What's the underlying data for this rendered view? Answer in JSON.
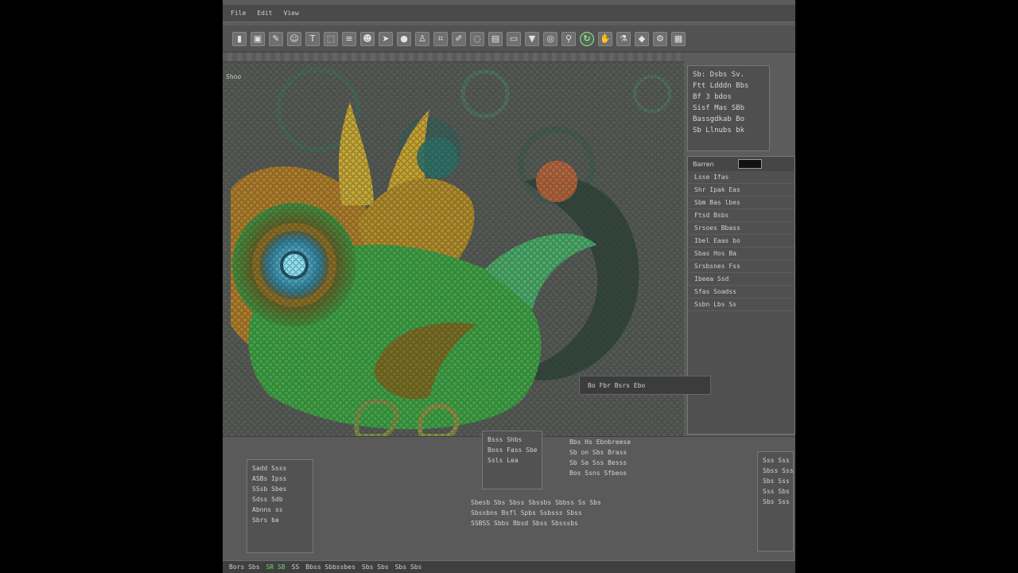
{
  "app": {
    "menu": [
      "File",
      "Edit",
      "View"
    ],
    "toolbar": [
      {
        "icon": "stamp-icon",
        "glyph": "▮"
      },
      {
        "icon": "image-icon",
        "glyph": "▣"
      },
      {
        "icon": "brush-icon",
        "glyph": "✎"
      },
      {
        "icon": "person-icon",
        "glyph": "☺"
      },
      {
        "icon": "text-icon",
        "glyph": "T"
      },
      {
        "icon": "select-icon",
        "glyph": "⬚"
      },
      {
        "icon": "layers-icon",
        "glyph": "≡"
      },
      {
        "icon": "face-icon",
        "glyph": "☻"
      },
      {
        "icon": "cursor-icon",
        "glyph": "➤"
      },
      {
        "icon": "circle-icon",
        "glyph": "●"
      },
      {
        "icon": "figure-icon",
        "glyph": "♙"
      },
      {
        "icon": "crop-icon",
        "glyph": "⌗"
      },
      {
        "icon": "pencil-icon",
        "glyph": "✐"
      },
      {
        "icon": "lasso-icon",
        "glyph": "◌"
      },
      {
        "icon": "gradient-icon",
        "glyph": "▤"
      },
      {
        "icon": "eraser-icon",
        "glyph": "▭"
      },
      {
        "icon": "fill-icon",
        "glyph": "▼"
      },
      {
        "icon": "globe-icon",
        "glyph": "◎"
      },
      {
        "icon": "zoom-icon",
        "glyph": "⚲"
      },
      {
        "icon": "rotate-icon",
        "glyph": "↻"
      },
      {
        "icon": "hand-icon",
        "glyph": "✋"
      },
      {
        "icon": "eyedropper-icon",
        "glyph": "⚗"
      },
      {
        "icon": "shape-icon",
        "glyph": "◆"
      },
      {
        "icon": "settings-icon",
        "glyph": "⚙"
      },
      {
        "icon": "grid-icon",
        "glyph": "▦"
      }
    ],
    "active_tool_index": 19,
    "canvas_label": "Shoo",
    "info_panel": [
      "Sb: Dsbs Sv.",
      "Ftt Ldddn Bbs",
      "Bf 3  bdos",
      "Sisf Mas SBb",
      "Bassgdkab  Bo",
      "Sb Llnubs bk"
    ],
    "layers_panel": {
      "title": "Barren",
      "rows": [
        "Lsse Ifas",
        "Shr Ipak Eas",
        "Sbm Bas lbes",
        "Ftsd Bsbs",
        "Srsoes Bbass",
        "Ibel Eaas bo",
        "Sbas Hos Ba",
        "Srsbsnes Fss",
        "Ibeea Ssd",
        "Sfas Soadss",
        "Ssbn Lbs Ss"
      ]
    },
    "tooltip": "Bo  Fbr Bsrs Ebo",
    "bottom_panel": {
      "left_box": [
        "Sadd  Ssss",
        "ASBs  Ipss",
        "SSsb  Sbes",
        "Sdss  Sdb",
        "Abnns  ss",
        "Sbrs  ba"
      ],
      "mid_box": [
        "Bsss Shbs",
        "Boss Fass Sbe",
        "Ssls Lea"
      ],
      "center_text": [
        "Bbs Hs  Ebnbreese",
        "Sb on Sbs Brass",
        "Sb Sa Sss Besss",
        "Bos Ssns Sfbeos"
      ],
      "footer_text": [
        "Sbesb Sbs Sbss  Sbssbs  Sbbss  Ss Sbs",
        "Sbssbns Bsfl Spbs  Ssbsss Sbss",
        "SSBSS Sbbs  Bbsd Sbss  Sbsssbs"
      ],
      "right_box": [
        "Sss  Sss",
        "Sbss  Sss",
        "Sbs  Sss",
        "Sss  Sbs",
        "Sbs  Sss"
      ]
    },
    "status_bar": [
      "Bors  Sbs",
      "SR SB",
      "SS",
      "Bbss Sbbssbes",
      "Sbs  Sbs",
      "Sbs  Sbs"
    ],
    "colors": {
      "accent": "#6fd46f",
      "panel": "#505050",
      "background": "#5c5c5c"
    }
  }
}
